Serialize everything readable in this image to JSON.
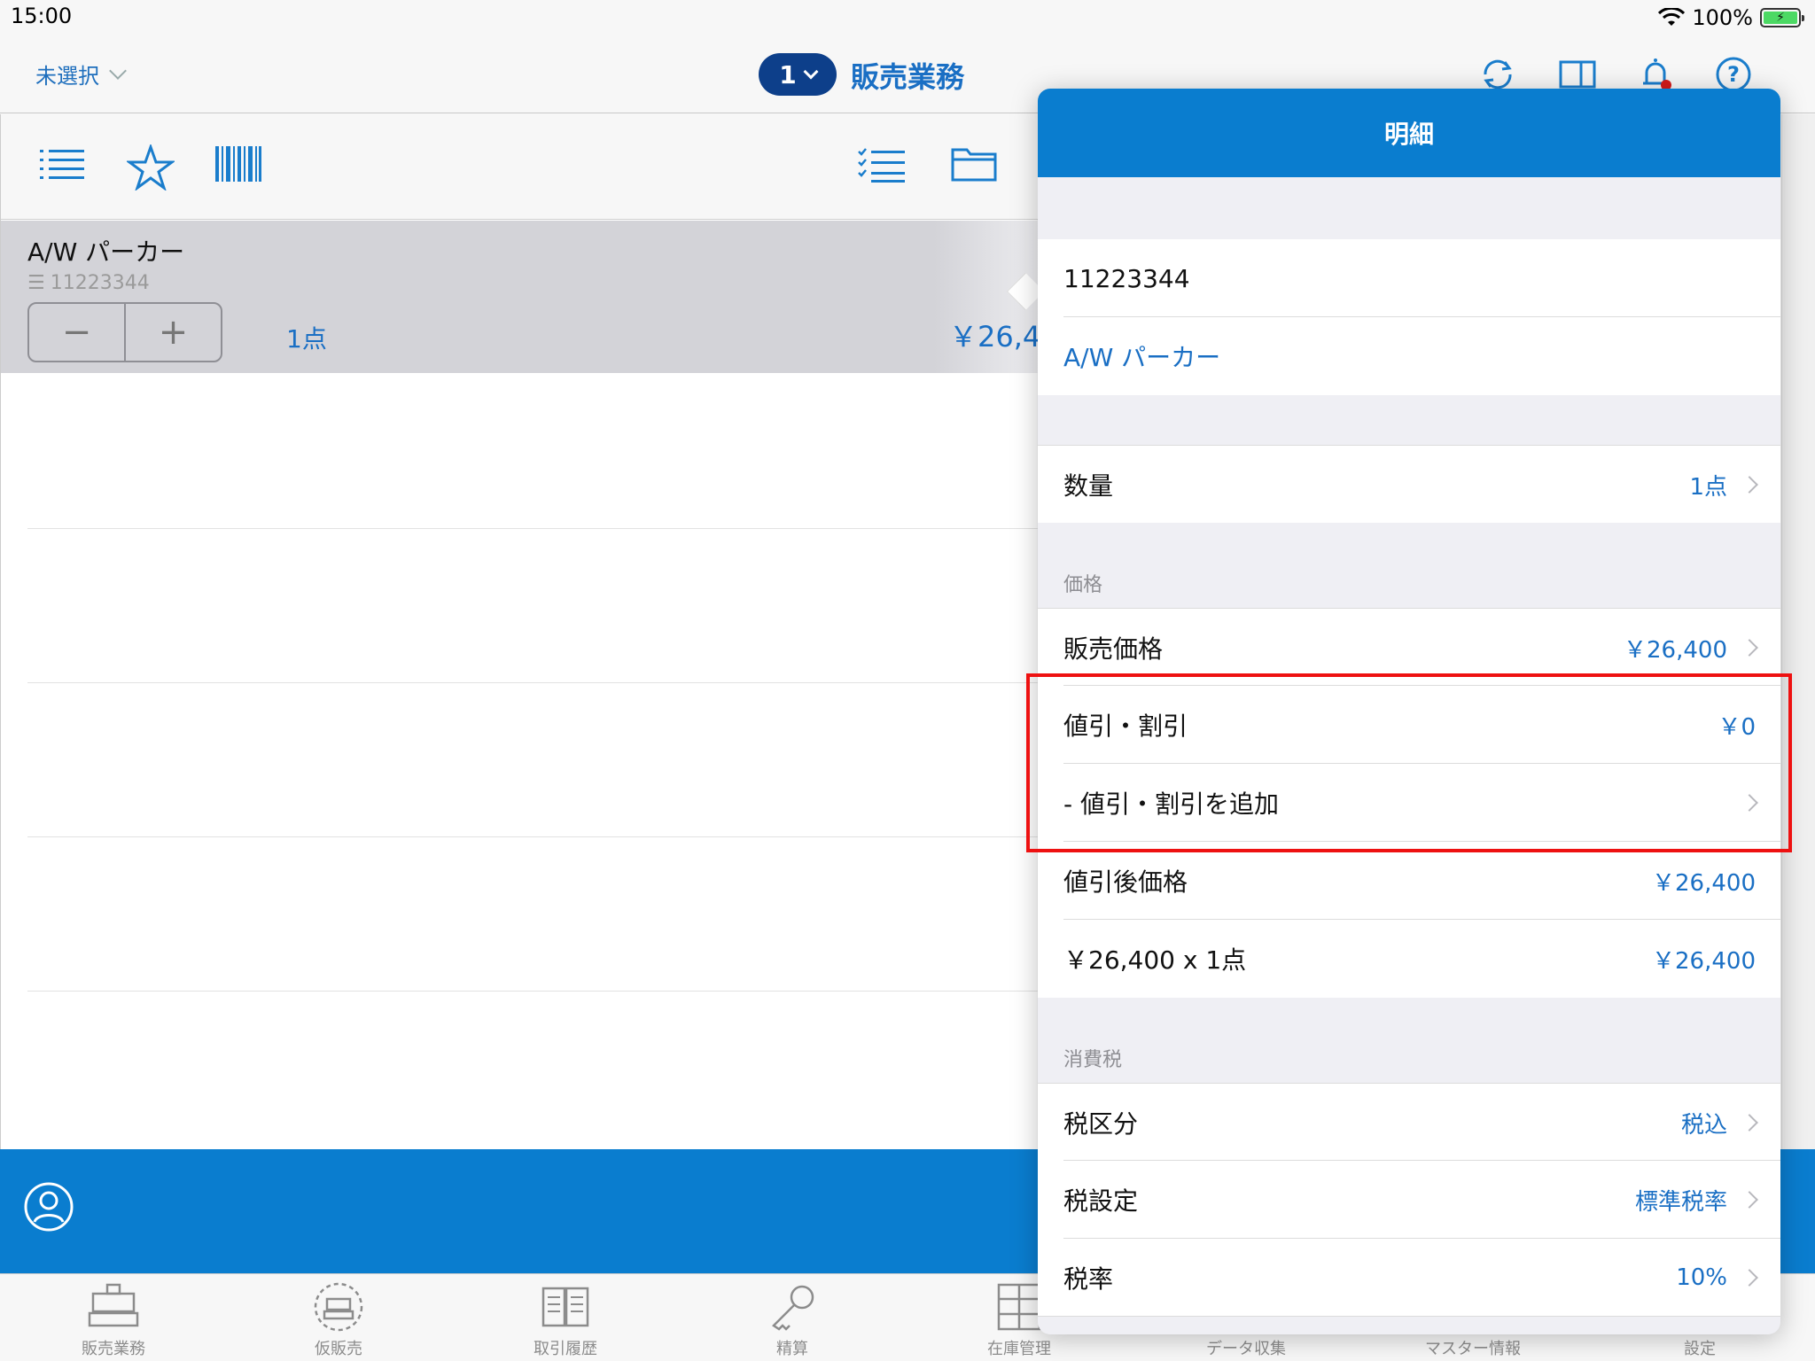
{
  "status_bar": {
    "time": "15:00",
    "battery": "100%"
  },
  "nav": {
    "store_selector": "未選択",
    "register_number": "1",
    "title": "販売業務"
  },
  "item": {
    "name": "A/W パーカー",
    "code": "11223344",
    "minus": "−",
    "plus": "+",
    "quantity": "1点",
    "price": "￥26,4"
  },
  "popover": {
    "title": "明細",
    "code": "11223344",
    "name": "A/W パーカー",
    "quantity_label": "数量",
    "quantity_value": "1点",
    "price_section": "価格",
    "sale_price_label": "販売価格",
    "sale_price_value": "￥26,400",
    "discount_label": "値引・割引",
    "discount_value": "￥0",
    "add_discount_label": "- 値引・割引を追加",
    "after_discount_label": "値引後価格",
    "after_discount_value": "￥26,400",
    "subtotal_label": "￥26,400 x 1点",
    "subtotal_value": "￥26,400",
    "tax_section": "消費税",
    "tax_class_label": "税区分",
    "tax_class_value": "税込",
    "tax_setting_label": "税設定",
    "tax_setting_value": "標準税率",
    "tax_rate_label": "税率",
    "tax_rate_value": "10%"
  },
  "tabs": [
    {
      "label": "販売業務"
    },
    {
      "label": "仮販売"
    },
    {
      "label": "取引履歴"
    },
    {
      "label": "精算"
    },
    {
      "label": "在庫管理"
    },
    {
      "label": "データ収集"
    },
    {
      "label": "マスター情報"
    },
    {
      "label": "設定"
    }
  ],
  "colors": {
    "accent": "#0a7dcf",
    "highlight": "#ee1111",
    "text_link": "#1a6fc4"
  }
}
